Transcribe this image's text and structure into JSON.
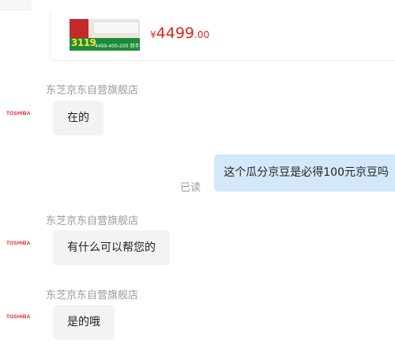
{
  "product": {
    "thumb_price": "3119",
    "thumb_text": "4499-400-200 到手价",
    "price_symbol": "¥",
    "price_integer": "4499",
    "price_decimal": ".00"
  },
  "messages": [
    {
      "direction": "in",
      "sender": "东芝京东自营旗舰店",
      "avatar_text": "TOSHIBA",
      "text": "在的"
    },
    {
      "direction": "out",
      "status": "已读",
      "text": "这个瓜分京豆是必得100元京豆吗"
    },
    {
      "direction": "in",
      "sender": "东芝京东自营旗舰店",
      "avatar_text": "TOSHIBA",
      "text": "有什么可以帮您的"
    },
    {
      "direction": "in",
      "sender": "东芝京东自营旗舰店",
      "avatar_text": "TOSHIBA",
      "text": "是的哦"
    }
  ],
  "colors": {
    "price": "#e1251b",
    "brand_logo": "#d8262b",
    "incoming_bubble": "#f3f3f3",
    "outgoing_bubble": "#d5e8fb",
    "meta_text": "#9a9a9a"
  }
}
